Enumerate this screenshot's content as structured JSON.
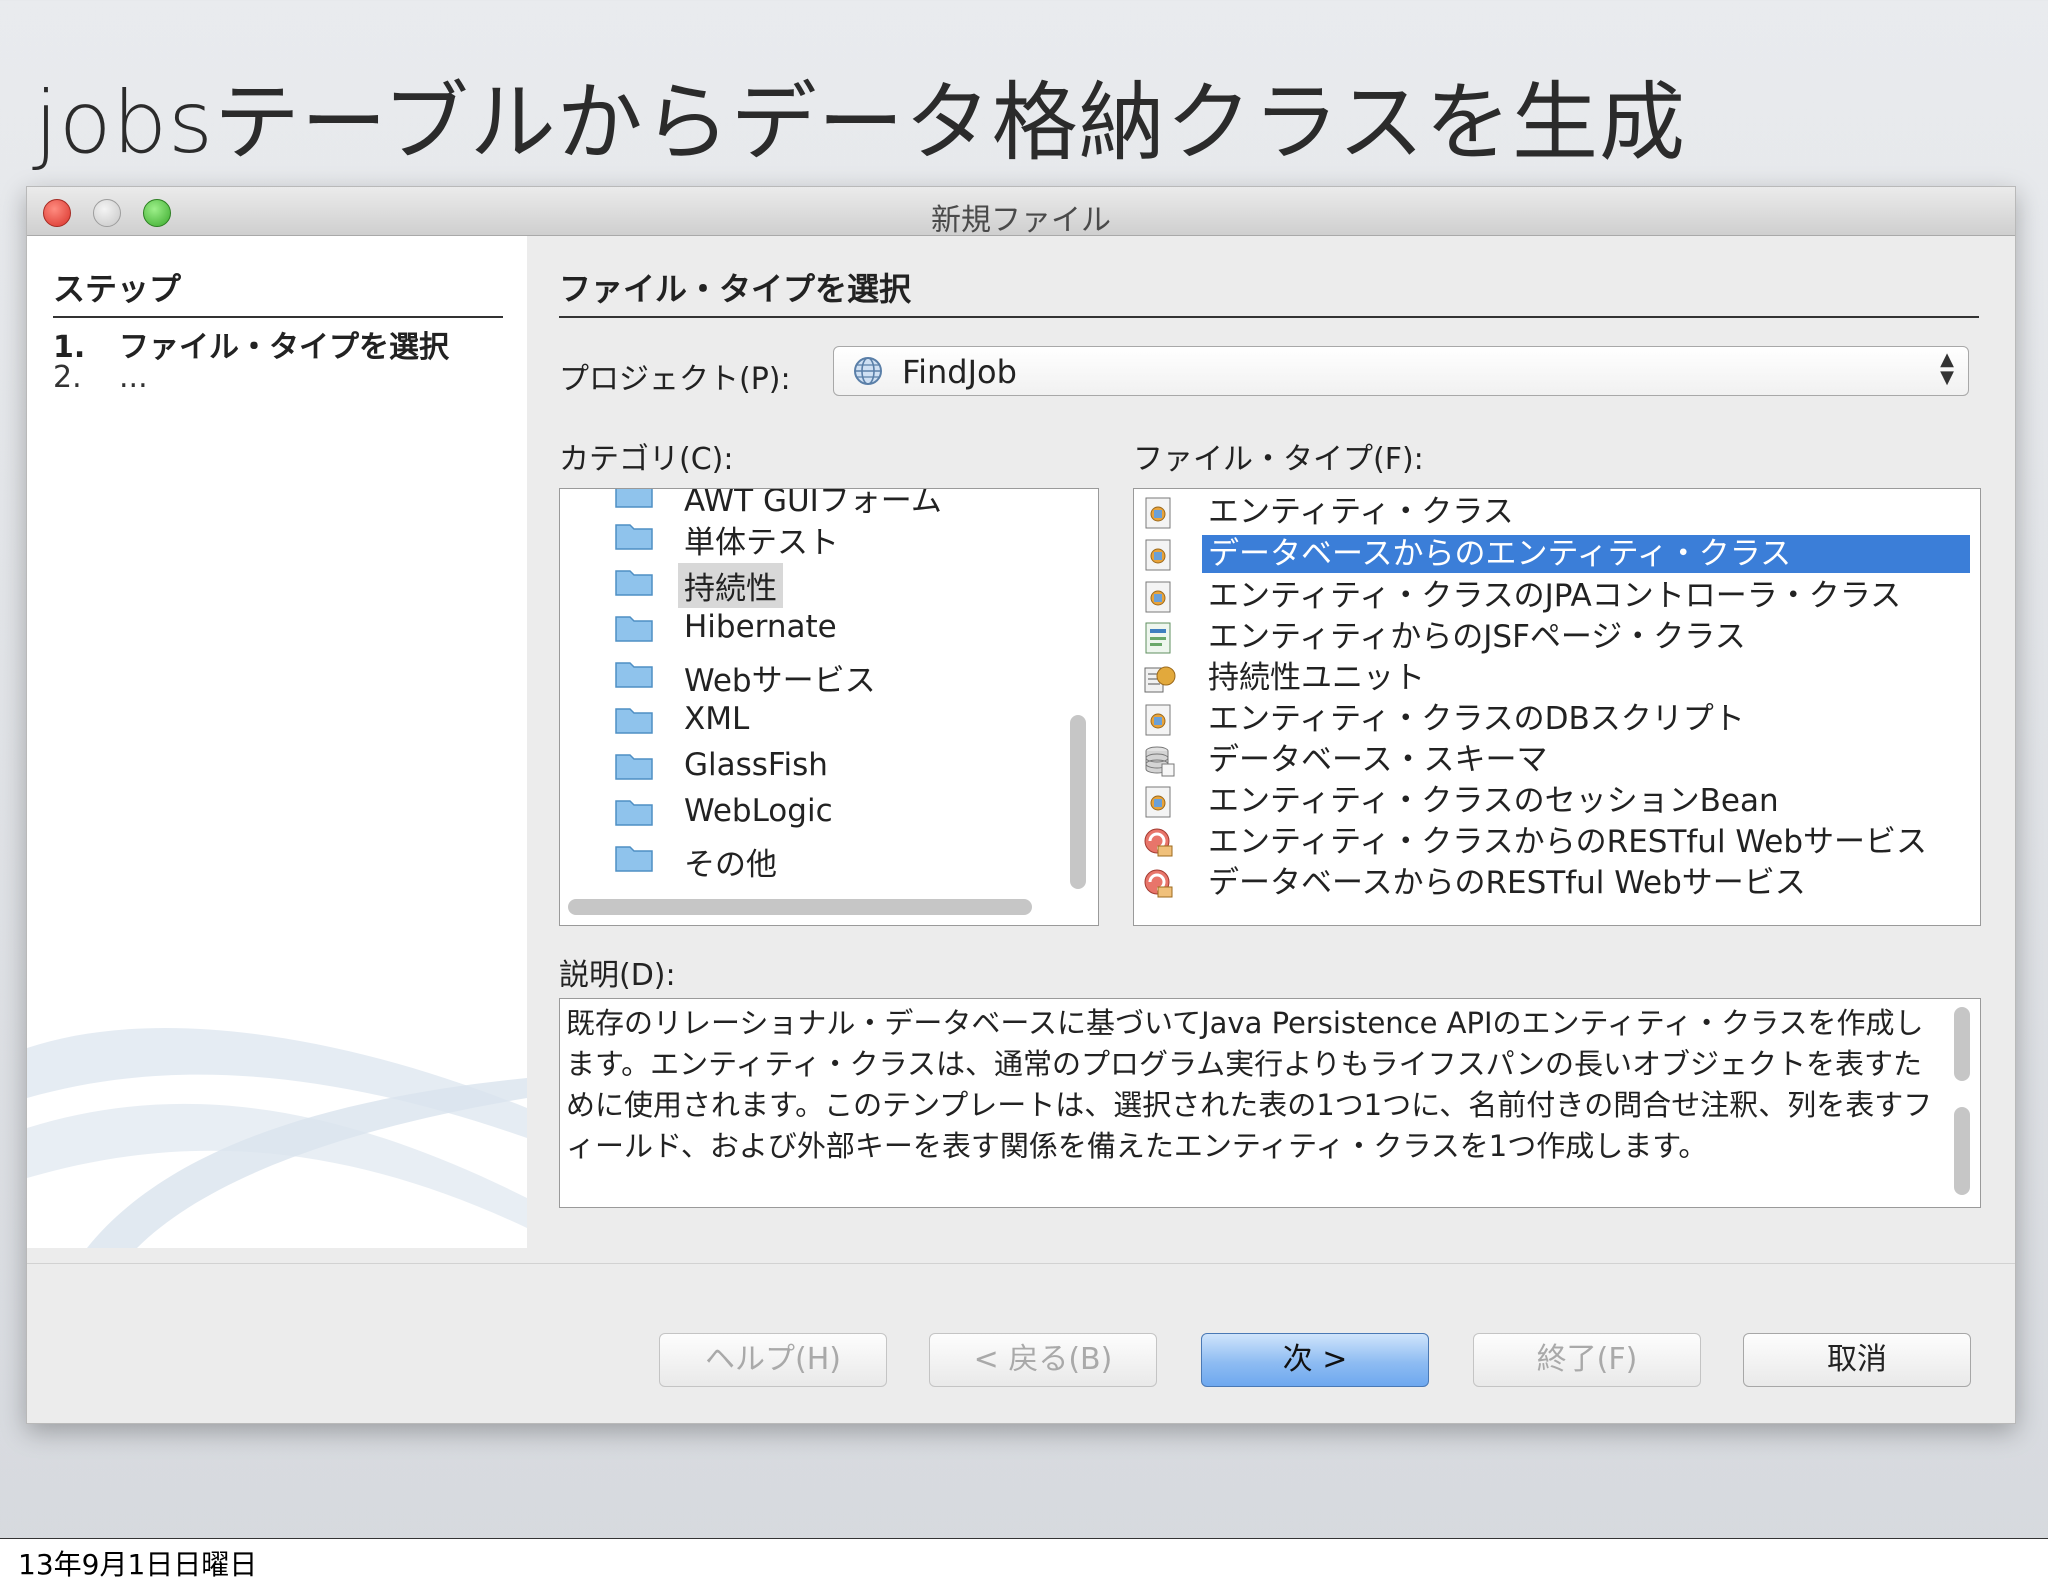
{
  "slide": {
    "title": "jobsテーブルからデータ格納クラスを生成",
    "date": "13年9月1日日曜日"
  },
  "window": {
    "title": "新規ファイル"
  },
  "steps": {
    "heading": "ステップ",
    "items": [
      {
        "num": "1.",
        "label": "ファイル・タイプを選択"
      },
      {
        "num": "2.",
        "label": "..."
      }
    ]
  },
  "main": {
    "heading": "ファイル・タイプを選択",
    "project_label": "プロジェクト(P):",
    "project_value": "FindJob",
    "category_label": "カテゴリ(C):",
    "filetype_label": "ファイル・タイプ(F):",
    "description_label": "説明(D):",
    "description": "既存のリレーショナル・データベースに基づいてJava Persistence APIのエンティティ・クラスを作成します。エンティティ・クラスは、通常のプログラム実行よりもライフスパンの長いオブジェクトを表すために使用されます。このテンプレートは、選択された表の1つ1つに、名前付きの問合せ注釈、列を表すフィールド、および外部キーを表す関係を備えたエンティティ・クラスを1つ作成します。"
  },
  "categories": [
    "AWT GUIフォーム",
    "単体テスト",
    "持続性",
    "Hibernate",
    "Webサービス",
    "XML",
    "GlassFish",
    "WebLogic",
    "その他"
  ],
  "categories_selected": "持続性",
  "file_types": [
    {
      "label": "エンティティ・クラス",
      "icon": "entity-class-icon"
    },
    {
      "label": "データベースからのエンティティ・クラス",
      "icon": "entity-class-icon"
    },
    {
      "label": "エンティティ・クラスのJPAコントローラ・クラス",
      "icon": "entity-class-icon"
    },
    {
      "label": "エンティティからのJSFページ・クラス",
      "icon": "jsf-page-icon"
    },
    {
      "label": "持続性ユニット",
      "icon": "persistence-unit-icon"
    },
    {
      "label": "エンティティ・クラスのDBスクリプト",
      "icon": "entity-class-icon"
    },
    {
      "label": "データベース・スキーマ",
      "icon": "database-schema-icon"
    },
    {
      "label": "エンティティ・クラスのセッションBean",
      "icon": "entity-class-icon"
    },
    {
      "label": "エンティティ・クラスからのRESTful Webサービス",
      "icon": "restful-service-icon"
    },
    {
      "label": "データベースからのRESTful Webサービス",
      "icon": "restful-service-icon"
    }
  ],
  "file_types_selected": "データベースからのエンティティ・クラス",
  "buttons": {
    "help": "ヘルプ(H)",
    "back": "< 戻る(B)",
    "next": "次 >",
    "finish": "終了(F)",
    "cancel": "取消"
  },
  "colors": {
    "selection": "#3b7ed8",
    "primary_button": "#8ebcf2"
  }
}
